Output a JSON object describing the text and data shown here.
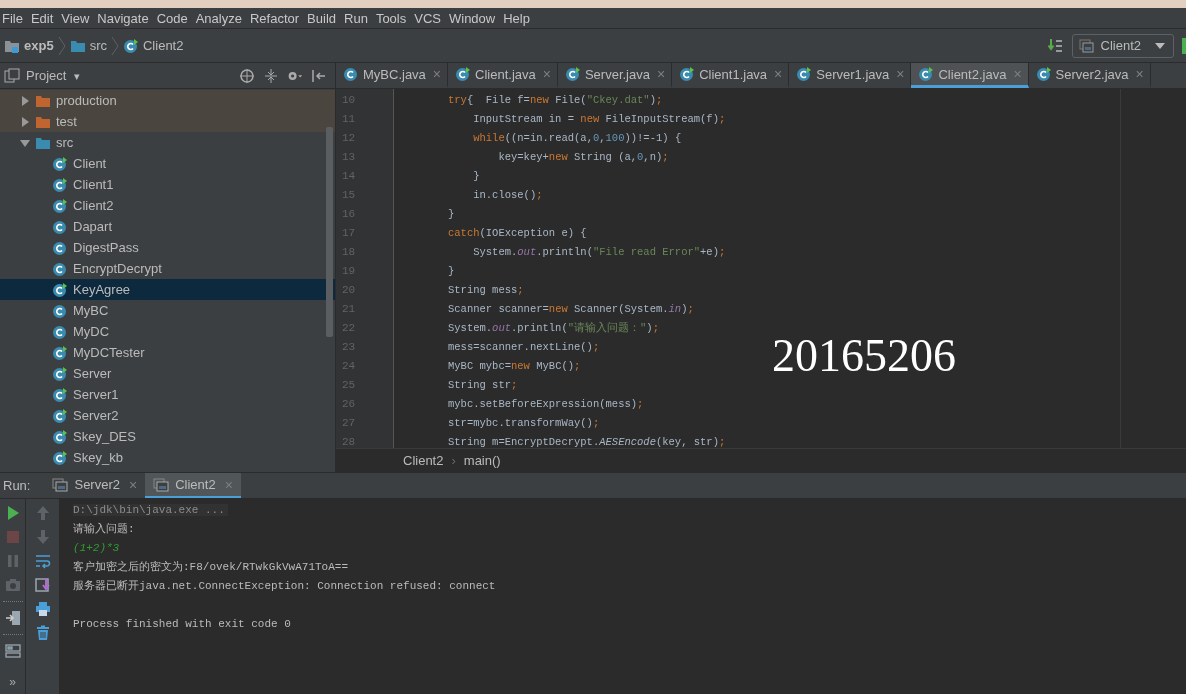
{
  "menu": [
    "File",
    "Edit",
    "View",
    "Navigate",
    "Code",
    "Analyze",
    "Refactor",
    "Build",
    "Run",
    "Tools",
    "VCS",
    "Window",
    "Help"
  ],
  "breadcrumb": [
    {
      "label": "exp5",
      "kind": "module"
    },
    {
      "label": "src",
      "kind": "folder"
    },
    {
      "label": "Client2",
      "kind": "class"
    }
  ],
  "run_config": {
    "label": "Client2"
  },
  "project_panel": {
    "title": "Project",
    "caret": "▾",
    "tree": [
      {
        "label": "production",
        "kind": "folder",
        "color": "#c0652f",
        "excluded": true,
        "expanded": false,
        "selected": false
      },
      {
        "label": "test",
        "kind": "folder",
        "color": "#c0652f",
        "excluded": true,
        "expanded": false,
        "selected": false
      },
      {
        "label": "src",
        "kind": "folder",
        "color": "#3a8bb0",
        "excluded": false,
        "expanded": true,
        "selected": false,
        "children": [
          {
            "label": "Client",
            "kind": "class",
            "runnable": true,
            "selected": false
          },
          {
            "label": "Client1",
            "kind": "class",
            "runnable": true,
            "selected": false
          },
          {
            "label": "Client2",
            "kind": "class",
            "runnable": true,
            "selected": false
          },
          {
            "label": "Dapart",
            "kind": "class",
            "runnable": false,
            "selected": false
          },
          {
            "label": "DigestPass",
            "kind": "class",
            "runnable": false,
            "selected": false
          },
          {
            "label": "EncryptDecrypt",
            "kind": "class",
            "runnable": false,
            "selected": false
          },
          {
            "label": "KeyAgree",
            "kind": "class",
            "runnable": true,
            "selected": true
          },
          {
            "label": "MyBC",
            "kind": "class",
            "runnable": false,
            "selected": false
          },
          {
            "label": "MyDC",
            "kind": "class",
            "runnable": false,
            "selected": false
          },
          {
            "label": "MyDCTester",
            "kind": "class",
            "runnable": true,
            "selected": false
          },
          {
            "label": "Server",
            "kind": "class",
            "runnable": true,
            "selected": false
          },
          {
            "label": "Server1",
            "kind": "class",
            "runnable": true,
            "selected": false
          },
          {
            "label": "Server2",
            "kind": "class",
            "runnable": true,
            "selected": false
          },
          {
            "label": "Skey_DES",
            "kind": "class",
            "runnable": true,
            "selected": false
          },
          {
            "label": "Skey_kb",
            "kind": "class",
            "runnable": true,
            "selected": false
          }
        ]
      }
    ]
  },
  "editor_tabs": [
    {
      "label": "MyBC.java",
      "runnable": false,
      "selected": false,
      "close": "×"
    },
    {
      "label": "Client.java",
      "runnable": true,
      "selected": false,
      "close": "×"
    },
    {
      "label": "Server.java",
      "runnable": true,
      "selected": false,
      "close": "×"
    },
    {
      "label": "Client1.java",
      "runnable": true,
      "selected": false,
      "close": "×"
    },
    {
      "label": "Server1.java",
      "runnable": true,
      "selected": false,
      "close": "×"
    },
    {
      "label": "Client2.java",
      "runnable": true,
      "selected": true,
      "close": "×"
    },
    {
      "label": "Server2.java",
      "runnable": true,
      "selected": false,
      "close": "×"
    }
  ],
  "code_lines": [
    {
      "number": "10",
      "tokens": [
        {
          "kind": "keyword",
          "text": "try"
        },
        {
          "kind": "plain",
          "text": "{  File f="
        },
        {
          "kind": "keyword",
          "text": "new"
        },
        {
          "kind": "plain",
          "text": " File("
        },
        {
          "kind": "string",
          "text": "\"Ckey.dat\""
        },
        {
          "kind": "plain",
          "text": ")"
        },
        {
          "kind": "keyword",
          "text": ";"
        }
      ]
    },
    {
      "number": "11",
      "tokens": [
        {
          "kind": "plain",
          "text": "    InputStream in = "
        },
        {
          "kind": "keyword",
          "text": "new"
        },
        {
          "kind": "plain",
          "text": " FileInputStream(f)"
        },
        {
          "kind": "keyword",
          "text": ";"
        }
      ]
    },
    {
      "number": "12",
      "tokens": [
        {
          "kind": "keyword",
          "text": "    while"
        },
        {
          "kind": "plain",
          "text": "((n=in.read(a,"
        },
        {
          "kind": "number",
          "text": "0"
        },
        {
          "kind": "plain",
          "text": ","
        },
        {
          "kind": "number",
          "text": "100"
        },
        {
          "kind": "plain",
          "text": "))!=-1) {"
        }
      ]
    },
    {
      "number": "13",
      "tokens": [
        {
          "kind": "plain",
          "text": "        key=key+"
        },
        {
          "kind": "keyword",
          "text": "new"
        },
        {
          "kind": "plain",
          "text": " String (a,"
        },
        {
          "kind": "number",
          "text": "0"
        },
        {
          "kind": "plain",
          "text": ",n)"
        },
        {
          "kind": "keyword",
          "text": ";"
        }
      ]
    },
    {
      "number": "14",
      "tokens": [
        {
          "kind": "plain",
          "text": "    }"
        }
      ]
    },
    {
      "number": "15",
      "tokens": [
        {
          "kind": "plain",
          "text": "    in.close()"
        },
        {
          "kind": "keyword",
          "text": ";"
        }
      ]
    },
    {
      "number": "16",
      "tokens": [
        {
          "kind": "plain",
          "text": "}"
        }
      ]
    },
    {
      "number": "17",
      "tokens": [
        {
          "kind": "keyword",
          "text": "catch"
        },
        {
          "kind": "plain",
          "text": "(IOException e) {"
        }
      ]
    },
    {
      "number": "18",
      "tokens": [
        {
          "kind": "plain",
          "text": "    System."
        },
        {
          "kind": "static",
          "text": "out"
        },
        {
          "kind": "plain",
          "text": ".println("
        },
        {
          "kind": "string",
          "text": "\"File read Error\""
        },
        {
          "kind": "plain",
          "text": "+e)"
        },
        {
          "kind": "keyword",
          "text": ";"
        }
      ]
    },
    {
      "number": "19",
      "tokens": [
        {
          "kind": "plain",
          "text": "}"
        }
      ]
    },
    {
      "number": "20",
      "tokens": [
        {
          "kind": "plain",
          "text": "String mess"
        },
        {
          "kind": "keyword",
          "text": ";"
        }
      ]
    },
    {
      "number": "21",
      "tokens": [
        {
          "kind": "plain",
          "text": "Scanner scanner="
        },
        {
          "kind": "keyword",
          "text": "new"
        },
        {
          "kind": "plain",
          "text": " Scanner(System."
        },
        {
          "kind": "static",
          "text": "in"
        },
        {
          "kind": "plain",
          "text": ")"
        },
        {
          "kind": "keyword",
          "text": ";"
        }
      ]
    },
    {
      "number": "22",
      "tokens": [
        {
          "kind": "plain",
          "text": "System."
        },
        {
          "kind": "static",
          "text": "out"
        },
        {
          "kind": "plain",
          "text": ".println("
        },
        {
          "kind": "string",
          "text": "\"请输入问题：\""
        },
        {
          "kind": "plain",
          "text": ")"
        },
        {
          "kind": "keyword",
          "text": ";"
        }
      ]
    },
    {
      "number": "23",
      "tokens": [
        {
          "kind": "plain",
          "text": "mess=scanner.nextLine()"
        },
        {
          "kind": "keyword",
          "text": ";"
        }
      ]
    },
    {
      "number": "24",
      "tokens": [
        {
          "kind": "plain",
          "text": "MyBC mybc="
        },
        {
          "kind": "keyword",
          "text": "new"
        },
        {
          "kind": "plain",
          "text": " MyBC()"
        },
        {
          "kind": "keyword",
          "text": ";"
        }
      ]
    },
    {
      "number": "25",
      "tokens": [
        {
          "kind": "plain",
          "text": "String str"
        },
        {
          "kind": "keyword",
          "text": ";"
        }
      ]
    },
    {
      "number": "26",
      "tokens": [
        {
          "kind": "plain",
          "text": "mybc.setBeforeExpression(mess)"
        },
        {
          "kind": "keyword",
          "text": ";"
        }
      ]
    },
    {
      "number": "27",
      "tokens": [
        {
          "kind": "plain",
          "text": "str=mybc.transformWay()"
        },
        {
          "kind": "keyword",
          "text": ";"
        }
      ]
    },
    {
      "number": "28",
      "tokens": [
        {
          "kind": "plain",
          "text": "String m=EncryptDecrypt."
        },
        {
          "kind": "italic",
          "text": "AESEncode"
        },
        {
          "kind": "plain",
          "text": "(key, str)"
        },
        {
          "kind": "keyword",
          "text": ";"
        }
      ]
    }
  ],
  "overlay_text": "20165206",
  "editor_breadcrumb": [
    "Client2",
    "main()"
  ],
  "editor_breadcrumb_separator": "›",
  "run_panel": {
    "label": "Run:",
    "tabs": [
      {
        "label": "Server2",
        "selected": false,
        "close": "×"
      },
      {
        "label": "Client2",
        "selected": true,
        "close": "×"
      }
    ],
    "toolbar_left": [
      {
        "kind": "run",
        "disabled": false
      },
      {
        "kind": "stop",
        "disabled": true
      },
      {
        "kind": "pause",
        "disabled": true
      },
      {
        "kind": "camera",
        "disabled": true
      },
      {
        "kind": "exit",
        "disabled": false
      },
      {
        "kind": "layout",
        "disabled": false
      }
    ],
    "more": "»",
    "toolbar_right": [
      {
        "kind": "up",
        "disabled": true
      },
      {
        "kind": "down",
        "disabled": true
      },
      {
        "kind": "wrap",
        "disabled": false
      },
      {
        "kind": "scroll-end",
        "disabled": false
      },
      {
        "kind": "print",
        "disabled": false
      },
      {
        "kind": "trash",
        "disabled": false
      }
    ],
    "console": [
      {
        "kind": "command",
        "text": "D:\\jdk\\bin\\java.exe ..."
      },
      {
        "kind": "output",
        "text": "请输入问题:"
      },
      {
        "kind": "input",
        "text": "(1+2)*3"
      },
      {
        "kind": "output",
        "text": "客户加密之后的密文为:F8/ovek/RTwkGkVwA71ToA=="
      },
      {
        "kind": "output",
        "text": "服务器已断开java.net.ConnectException: Connection refused: connect"
      },
      {
        "kind": "blank"
      },
      {
        "kind": "output",
        "text": "Process finished with exit code 0"
      }
    ]
  }
}
